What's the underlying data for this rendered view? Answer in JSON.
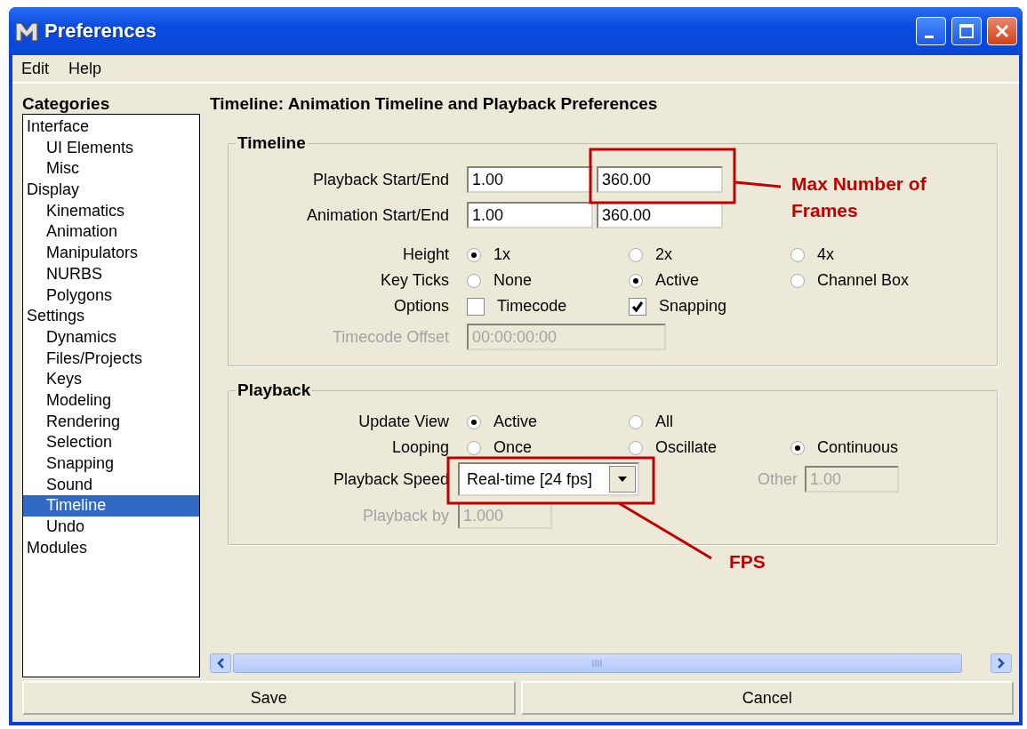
{
  "window": {
    "title": "Preferences"
  },
  "menu": [
    "Edit",
    "Help"
  ],
  "categories": {
    "title": "Categories",
    "items": [
      {
        "label": "Interface",
        "selected": false,
        "children": [
          {
            "label": "UI Elements",
            "selected": false
          },
          {
            "label": "Misc",
            "selected": false
          }
        ]
      },
      {
        "label": "Display",
        "selected": false,
        "children": [
          {
            "label": "Kinematics",
            "selected": false
          },
          {
            "label": "Animation",
            "selected": false
          },
          {
            "label": "Manipulators",
            "selected": false
          },
          {
            "label": "NURBS",
            "selected": false
          },
          {
            "label": "Polygons",
            "selected": false
          }
        ]
      },
      {
        "label": "Settings",
        "selected": false,
        "children": [
          {
            "label": "Dynamics",
            "selected": false
          },
          {
            "label": "Files/Projects",
            "selected": false
          },
          {
            "label": "Keys",
            "selected": false
          },
          {
            "label": "Modeling",
            "selected": false
          },
          {
            "label": "Rendering",
            "selected": false
          },
          {
            "label": "Selection",
            "selected": false
          },
          {
            "label": "Snapping",
            "selected": false
          },
          {
            "label": "Sound",
            "selected": false
          },
          {
            "label": "Timeline",
            "selected": true
          },
          {
            "label": "Undo",
            "selected": false
          }
        ]
      },
      {
        "label": "Modules",
        "selected": false
      }
    ]
  },
  "content": {
    "title": "Timeline: Animation Timeline and Playback Preferences",
    "sections": [
      {
        "title": "Timeline",
        "rows": [
          {
            "kind": "fields",
            "label": "Playback Start/End",
            "disabled": false,
            "fields": [
              "1.00",
              "360.00"
            ]
          },
          {
            "kind": "fields",
            "label": "Animation Start/End",
            "disabled": false,
            "fields": [
              "1.00",
              "360.00"
            ]
          },
          {
            "kind": "radio",
            "label": "Height",
            "options": [
              {
                "label": "1x",
                "selected": true
              },
              {
                "label": "2x",
                "selected": false
              },
              {
                "label": "4x",
                "selected": false
              }
            ]
          },
          {
            "kind": "radio",
            "label": "Key Ticks",
            "options": [
              {
                "label": "None",
                "selected": false
              },
              {
                "label": "Active",
                "selected": true
              },
              {
                "label": "Channel Box",
                "selected": false
              }
            ]
          },
          {
            "kind": "check",
            "label": "Options",
            "options": [
              {
                "label": "Timecode",
                "checked": false
              },
              {
                "label": "Snapping",
                "checked": true
              }
            ]
          },
          {
            "kind": "fields",
            "label": "Timecode Offset",
            "disabled": true,
            "fields": [
              "00:00:00:00"
            ]
          }
        ]
      },
      {
        "title": "Playback",
        "rows": [
          {
            "kind": "radio",
            "label": "Update View",
            "options": [
              {
                "label": "Active",
                "selected": true
              },
              {
                "label": "All",
                "selected": false
              }
            ]
          },
          {
            "kind": "radio",
            "label": "Looping",
            "options": [
              {
                "label": "Once",
                "selected": false
              },
              {
                "label": "Oscillate",
                "selected": false
              },
              {
                "label": "Continuous",
                "selected": true
              }
            ]
          },
          {
            "kind": "dropdown",
            "label": "Playback Speed",
            "value": "Real-time [24 fps]",
            "extra_label": "Other",
            "extra_value": "1.00",
            "extra_disabled": true
          },
          {
            "kind": "fields",
            "label": "Playback by",
            "disabled": true,
            "fields": [
              "1.000"
            ]
          }
        ]
      }
    ]
  },
  "buttons": [
    "Save",
    "Cancel"
  ],
  "annotations": [
    {
      "text": "Max Number of Frames"
    },
    {
      "text": "FPS"
    }
  ]
}
